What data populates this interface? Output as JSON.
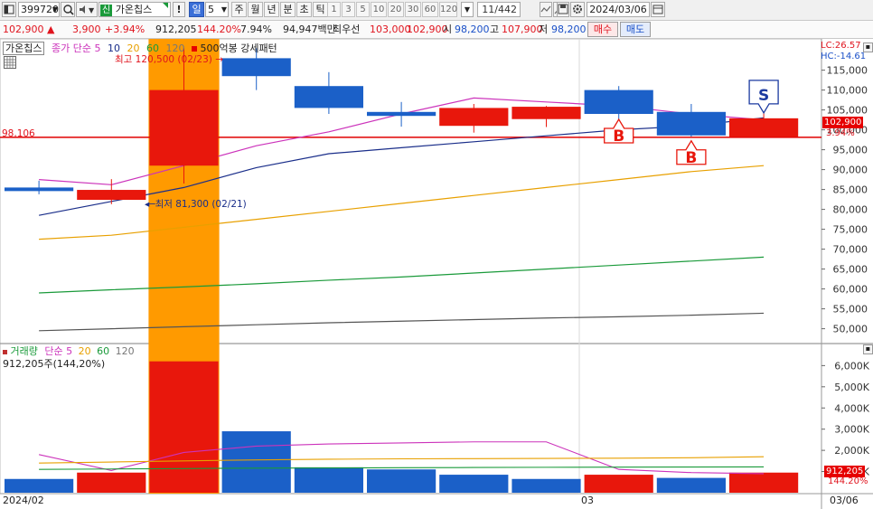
{
  "toolbar": {
    "code": "399720",
    "name_badge": "신",
    "name": "가온칩스",
    "bang": "!",
    "interval_label": "일",
    "interval_value": "5",
    "periods": [
      "주",
      "월",
      "년",
      "분",
      "초",
      "틱"
    ],
    "numbers": [
      "1",
      "3",
      "5",
      "10",
      "20",
      "30",
      "60",
      "120"
    ],
    "page_counter": "11/442",
    "date": "2024/03/06"
  },
  "quote": {
    "price": "102,900",
    "change_arrow": "▲",
    "change": "3,900",
    "change_pct": "+3.94%",
    "volume": "912,205",
    "volume_pct": "144.20%",
    "turnover_pct": "7.94%",
    "amount": "94,947백만",
    "best_label": "최우선",
    "best_ask": "103,000",
    "best_bid": "102,900",
    "open_label": "시",
    "open": "98,200",
    "high_label": "고",
    "high": "107,900",
    "low_label": "저",
    "low": "98,200",
    "buy_label": "매수",
    "sell_label": "매도"
  },
  "chart_data": [
    {
      "type": "candlestick",
      "legend": {
        "name": "가온칩스",
        "ma_label": "종가 단순",
        "ma_periods": [
          "5",
          "10",
          "20",
          "60",
          "120"
        ],
        "pattern": "500억봉 강세패턴"
      },
      "corner_labels": {
        "lc": "LC:26.57",
        "hc": "HC:-14.61"
      },
      "annotations": {
        "high": "최고 120,500 (02/23) →",
        "low": "최저 81,300 (02/21)",
        "ref_price": "98,106",
        "last_price": "102,900",
        "last_pct": "3.94%"
      },
      "signals": [
        {
          "index": 8,
          "label": "B",
          "side": "buy"
        },
        {
          "index": 9,
          "label": "B",
          "side": "buy"
        },
        {
          "index": 10,
          "label": "S",
          "side": "sell"
        }
      ],
      "y_ticks": [
        "115,000",
        "110,000",
        "105,000",
        "100,000",
        "95,000",
        "90,000",
        "85,000",
        "80,000",
        "75,000",
        "70,000",
        "65,000",
        "60,000",
        "55,000",
        "50,000"
      ],
      "ylim": [
        46500,
        121500
      ],
      "candles": [
        {
          "o": 85500,
          "h": 87200,
          "l": 83800,
          "c": 84600,
          "color": "blue"
        },
        {
          "o": 82400,
          "h": 87600,
          "l": 81300,
          "c": 84900,
          "color": "red"
        },
        {
          "o": 91000,
          "h": 120500,
          "l": 86500,
          "c": 110000,
          "color": "red",
          "highlight": true
        },
        {
          "o": 118000,
          "h": 120500,
          "l": 110000,
          "c": 113500,
          "color": "blue"
        },
        {
          "o": 111000,
          "h": 114500,
          "l": 104000,
          "c": 105500,
          "color": "blue"
        },
        {
          "o": 104500,
          "h": 107000,
          "l": 100800,
          "c": 103500,
          "color": "blue"
        },
        {
          "o": 101000,
          "h": 106500,
          "l": 99300,
          "c": 105500,
          "color": "red"
        },
        {
          "o": 102700,
          "h": 106000,
          "l": 100700,
          "c": 105800,
          "color": "red"
        },
        {
          "o": 110000,
          "h": 111000,
          "l": 101300,
          "c": 104000,
          "color": "blue"
        },
        {
          "o": 104500,
          "h": 106500,
          "l": 98300,
          "c": 98600,
          "color": "blue"
        },
        {
          "o": 98200,
          "h": 107900,
          "l": 98200,
          "c": 102900,
          "color": "red"
        }
      ],
      "series": [
        {
          "name": "5",
          "color": "#cc33bb",
          "values": [
            87500,
            86200,
            91000,
            96000,
            99500,
            104000,
            108000,
            107000,
            106000,
            104000,
            102500
          ]
        },
        {
          "name": "10",
          "color": "#1a2e8a",
          "values": [
            78500,
            82000,
            85500,
            90500,
            94000,
            95500,
            97000,
            98500,
            100000,
            101000,
            103000
          ]
        },
        {
          "name": "20",
          "color": "#e8a000",
          "values": [
            72500,
            73500,
            75500,
            77500,
            79500,
            81500,
            83500,
            85500,
            87500,
            89500,
            91000
          ]
        },
        {
          "name": "60",
          "color": "#1a9a3a",
          "values": [
            59000,
            59800,
            60500,
            61300,
            62200,
            63000,
            64000,
            65000,
            66000,
            67000,
            68000
          ]
        },
        {
          "name": "120",
          "color": "#555555",
          "values": [
            49500,
            50000,
            50500,
            51000,
            51500,
            51900,
            52300,
            52700,
            53000,
            53400,
            53900
          ]
        }
      ],
      "x_labels": [
        "2024/02",
        "03",
        "03/06"
      ]
    },
    {
      "type": "bar",
      "legend": {
        "name": "거래량",
        "ma_label": "단순",
        "ma_periods": [
          "5",
          "20",
          "60",
          "120"
        ]
      },
      "info": "912,205주(144,20%)",
      "y_ticks": [
        "6,000K",
        "5,000K",
        "4,000K",
        "3,000K",
        "2,000K",
        "1,000K"
      ],
      "ylim": [
        0,
        6400000
      ],
      "last_value": "912,205",
      "last_pct": "144.20%",
      "values": [
        650000,
        950000,
        6200000,
        2900000,
        1200000,
        1100000,
        850000,
        650000,
        850000,
        700000,
        950000
      ],
      "colors": [
        "blue",
        "red",
        "red",
        "blue",
        "blue",
        "blue",
        "blue",
        "blue",
        "red",
        "blue",
        "red"
      ],
      "series": [
        {
          "name": "5",
          "color": "#cc33bb",
          "values": [
            1800000,
            1050000,
            1900000,
            2200000,
            2300000,
            2350000,
            2400000,
            2400000,
            1100000,
            950000,
            900000
          ]
        },
        {
          "name": "20",
          "color": "#e8a000",
          "values": [
            1400000,
            1450000,
            1500000,
            1550000,
            1580000,
            1600000,
            1610000,
            1620000,
            1630000,
            1650000,
            1700000
          ]
        },
        {
          "name": "60",
          "color": "#1a9a3a",
          "values": [
            1100000,
            1120000,
            1140000,
            1160000,
            1170000,
            1180000,
            1190000,
            1200000,
            1210000,
            1215000,
            1220000
          ]
        }
      ]
    }
  ]
}
